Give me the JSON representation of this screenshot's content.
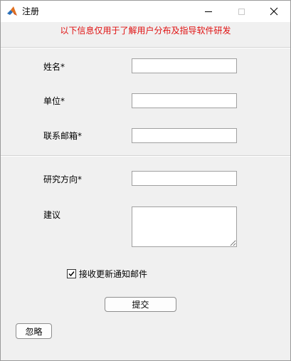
{
  "window": {
    "title": "注册"
  },
  "notice": "以下信息仅用于了解用户分布及指导软件研发",
  "form": {
    "name_label": "姓名*",
    "unit_label": "单位*",
    "email_label": "联系邮箱*",
    "research_label": "研究方向*",
    "suggestion_label": "建议",
    "name_value": "",
    "unit_value": "",
    "email_value": "",
    "research_value": "",
    "suggestion_value": ""
  },
  "subscribe": {
    "label": "接收更新通知邮件",
    "checked": true
  },
  "buttons": {
    "submit": "提交",
    "ignore": "忽略"
  },
  "icons": {
    "app": "matlab-icon",
    "minimize": "minimize-icon",
    "maximize": "maximize-icon",
    "close": "close-icon",
    "check": "check-icon"
  }
}
